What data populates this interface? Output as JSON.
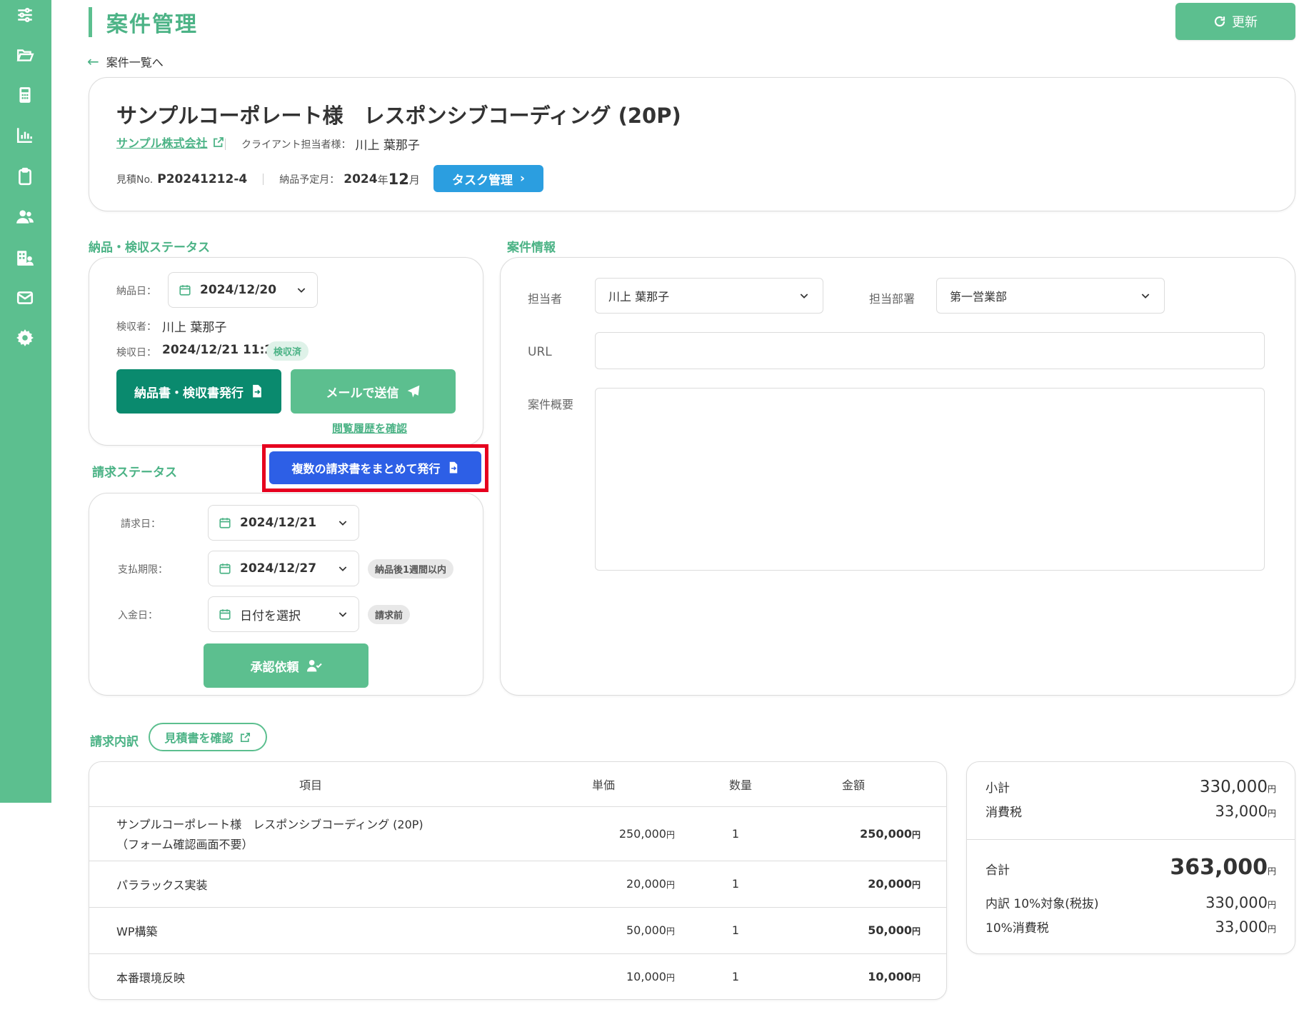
{
  "sidebar": {
    "items": [
      {
        "icon": "sliders-icon"
      },
      {
        "icon": "folder-open-icon"
      },
      {
        "icon": "calculator-icon"
      },
      {
        "icon": "bar-chart-icon"
      },
      {
        "icon": "clipboard-icon"
      },
      {
        "icon": "users-icon"
      },
      {
        "icon": "building-user-icon"
      },
      {
        "icon": "envelope-icon"
      },
      {
        "icon": "gear-icon"
      }
    ],
    "color": "#5cbf8f"
  },
  "header": {
    "title": "案件管理",
    "refresh_label": "更新",
    "back_label": "案件一覧へ"
  },
  "project": {
    "title": "サンプルコーポレート様　レスポンシブコーディング (20P)",
    "company": "サンプル株式会社",
    "client_contact_label": "クライアント担当者様：",
    "client_contact": "川上 葉那子",
    "estimate_label": "見積No.",
    "estimate_no": "P20241212-4",
    "delivery_month_label": "納品予定月：",
    "delivery_year": "2024",
    "year_unit": "年",
    "delivery_month": "12",
    "month_unit": "月",
    "task_button": "タスク管理"
  },
  "delivery": {
    "section_title": "納品・検収ステータス",
    "delivery_date_label": "納品日：",
    "delivery_date": "2024/12/20",
    "inspector_label": "検収者：",
    "inspector": "川上 葉那子",
    "inspection_date_label": "検収日：",
    "inspection_date": "2024/12/21 11:28",
    "inspection_badge": "検収済",
    "issue_button": "納品書・検収書発行",
    "mail_button": "メールで送信",
    "history_link": "閲覧履歴を確認"
  },
  "invoice": {
    "section_title": "請求ステータス",
    "multi_issue_button": "複数の請求書をまとめて発行",
    "invoice_date_label": "請求日：",
    "invoice_date": "2024/12/21",
    "due_date_label": "支払期限：",
    "due_date": "2024/12/27",
    "due_badge": "納品後1週間以内",
    "payment_date_label": "入金日：",
    "payment_date": "日付を選択",
    "payment_badge": "請求前",
    "approve_button": "承認依頼"
  },
  "info": {
    "section_title": "案件情報",
    "owner_label": "担当者",
    "owner": "川上 葉那子",
    "dept_label": "担当部署",
    "dept": "第一営業部",
    "url_label": "URL",
    "url_value": "",
    "summary_label": "案件概要",
    "summary_value": ""
  },
  "billing": {
    "section_title": "請求内訳",
    "quote_button": "見積書を確認",
    "columns": {
      "item": "項目",
      "unit": "単価",
      "qty": "数量",
      "amount": "金額"
    },
    "yen": "円",
    "rows": [
      {
        "name": "サンプルコーポレート様　レスポンシブコーディング (20P)",
        "name2": "（フォーム確認画面不要）",
        "unit": "250,000",
        "qty": "1",
        "amount": "250,000"
      },
      {
        "name": "パララックス実装",
        "name2": "",
        "unit": "20,000",
        "qty": "1",
        "amount": "20,000"
      },
      {
        "name": "WP構築",
        "name2": "",
        "unit": "50,000",
        "qty": "1",
        "amount": "50,000"
      },
      {
        "name": "本番環境反映",
        "name2": "",
        "unit": "10,000",
        "qty": "1",
        "amount": "10,000"
      }
    ]
  },
  "summary": {
    "subtotal_label": "小計",
    "subtotal": "330,000",
    "tax_label": "消費税",
    "tax": "33,000",
    "total_label": "合計",
    "total": "363,000",
    "breakdown_label": "内訳 10%対象(税抜)",
    "breakdown": "330,000",
    "tax10_label": "10%消費税",
    "tax10": "33,000"
  }
}
